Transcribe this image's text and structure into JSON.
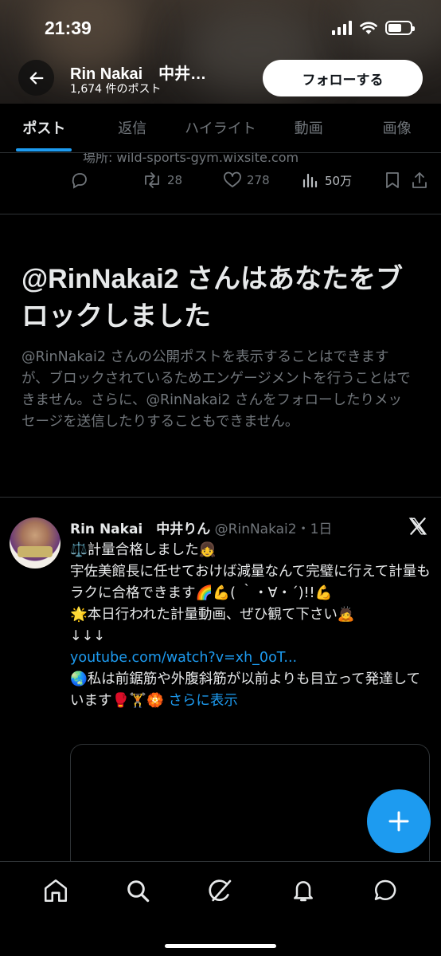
{
  "status_bar": {
    "time": "21:39"
  },
  "header": {
    "profile_name": "Rin Nakai　中井…",
    "post_count": "1,674 件のポスト",
    "follow_label": "フォローする"
  },
  "tabs": [
    {
      "label": "ポスト",
      "active": true
    },
    {
      "label": "返信",
      "active": false
    },
    {
      "label": "ハイライト",
      "active": false
    },
    {
      "label": "動画",
      "active": false
    },
    {
      "label": "画像",
      "active": false
    }
  ],
  "prev_post": {
    "text": "場所: wild-sports-gym.wixsite.com",
    "retweets": "28",
    "likes": "278",
    "views": "50万"
  },
  "block_notice": {
    "title": "@RinNakai2 さんはあなたをブロックしました",
    "description": "@RinNakai2 さんの公開ポストを表示することはできますが、ブロックされているためエンゲージメントを行うことはできません。さらに、@RinNakai2 さんをフォローしたりメッセージを送信したりすることもできません。"
  },
  "tweet": {
    "name": "Rin Nakai　中井りん",
    "handle_time": " @RinNakai2・1日",
    "line1": "⚖️計量合格しました👧",
    "line2": "宇佐美館長に任せておけば減量なんて完璧に行えて計量もラクに合格できます🌈💪( ｀・∀・´)!!💪",
    "line3": "🌟本日行われた計量動画、ぜひ観て下さい🙇",
    "line4": "↓↓↓",
    "link": "youtube.com/watch?v=xh_0oT...",
    "line5": "🌏私は前鋸筋や外腹斜筋が以前よりも目立って発達しています🥊🏋️🏵️ ",
    "more": "さらに表示"
  },
  "colors": {
    "accent": "#1d9bf0",
    "background": "#000000",
    "text": "#e7e9ea",
    "muted": "#71767b",
    "divider": "#2f3336"
  },
  "icons": {
    "back": "arrow-left-icon",
    "x_logo": "x-logo-icon",
    "compose": "plus-icon",
    "nav": [
      "home-icon",
      "search-icon",
      "grok-icon",
      "bell-icon",
      "message-icon"
    ]
  }
}
